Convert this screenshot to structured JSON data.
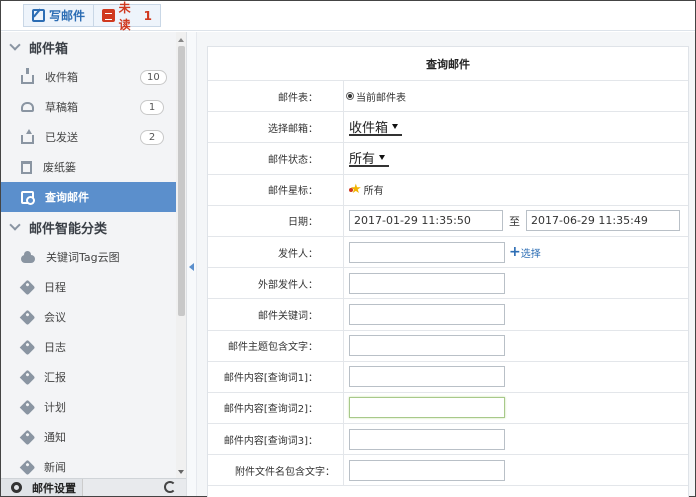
{
  "toolbar": {
    "compose_label": "写邮件",
    "unread_label": "未读",
    "unread_count": "1"
  },
  "sidebar": {
    "mailbox_group": "邮件箱",
    "folders": [
      {
        "label": "收件箱",
        "count": "10"
      },
      {
        "label": "草稿箱",
        "count": "1"
      },
      {
        "label": "已发送",
        "count": "2"
      },
      {
        "label": "废纸篓"
      },
      {
        "label": "查询邮件"
      }
    ],
    "smart_group": "邮件智能分类",
    "categories": [
      "关键词Tag云图",
      "日程",
      "会议",
      "日志",
      "汇报",
      "计划",
      "通知",
      "新闻"
    ],
    "settings_label": "邮件设置"
  },
  "form": {
    "title": "查询邮件",
    "mail_table_label": "邮件表：",
    "mail_table_option": "当前邮件表",
    "mailbox_label": "选择邮箱：",
    "mailbox_value": "收件箱",
    "status_label": "邮件状态：",
    "status_value": "所有",
    "star_label": "邮件星标：",
    "star_value": "所有",
    "date_label": "日期：",
    "date_from": "2017-01-29 11:35:50",
    "date_to_sep": "至",
    "date_to": "2017-06-29 11:35:49",
    "sender_label": "发件人：",
    "select_link": "选择",
    "external_sender_label": "外部发件人：",
    "keyword_label": "邮件关键词：",
    "subject_label": "邮件主题包含文字：",
    "content1_label": "邮件内容[查询词1]：",
    "content2_label": "邮件内容[查询词2]：",
    "content3_label": "邮件内容[查询词3]：",
    "attachment_label": "附件文件名包含文字："
  },
  "colors": {
    "accent": "#5b8fcc",
    "link": "#2c6db4",
    "unread": "#d0391f"
  }
}
